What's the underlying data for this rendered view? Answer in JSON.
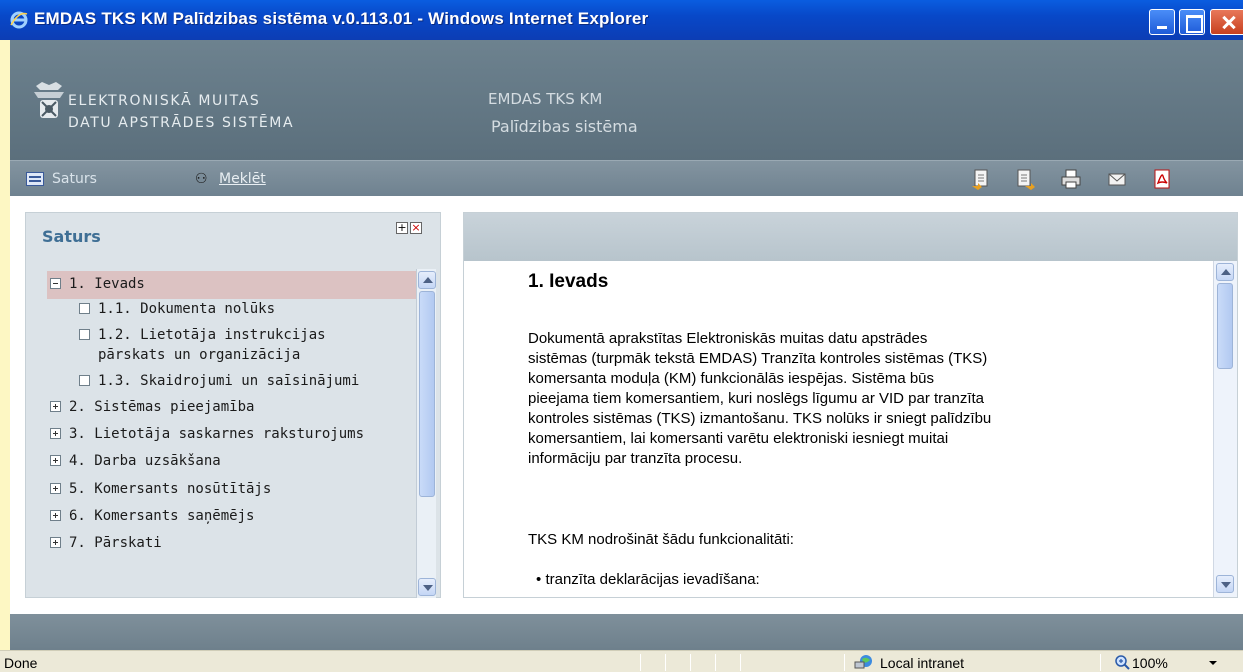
{
  "window": {
    "title": "EMDAS TKS KM Palīdzibas sistēma v.0.113.01 - Windows Internet Explorer"
  },
  "header": {
    "logo_line1": "ELEKTRONISKĀ MUITAS",
    "logo_line2": "DATU APSTRĀDES SISTĒMA",
    "app_name": "EMDAS TKS KM",
    "app_subtitle": "Palīdzibas sistēma"
  },
  "toolbar": {
    "saturs_label": "Saturs",
    "meklet_label": "Meklēt",
    "icons": [
      "previous-page-icon",
      "next-page-icon",
      "print-icon",
      "email-icon",
      "pdf-icon"
    ]
  },
  "toc": {
    "title": "Saturs",
    "items": [
      {
        "label": "1. Ievads",
        "toggle": "minus",
        "level": 0,
        "selected": true
      },
      {
        "label": "1.1. Dokumenta nolūks",
        "toggle": "leaf",
        "level": 1
      },
      {
        "label": "1.2. Lietotāja instrukcijas",
        "label2": "pārskats un organizācija",
        "toggle": "leaf",
        "level": 1
      },
      {
        "label": "1.3. Skaidrojumi un saīsinājumi",
        "toggle": "leaf",
        "level": 1
      },
      {
        "label": "2. Sistēmas pieejamība",
        "toggle": "plus",
        "level": 0
      },
      {
        "label": "3. Lietotāja saskarnes raksturojums",
        "toggle": "plus",
        "level": 0
      },
      {
        "label": "4. Darba uzsākšana",
        "toggle": "plus",
        "level": 0
      },
      {
        "label": "5. Komersants nosūtītājs",
        "toggle": "plus",
        "level": 0
      },
      {
        "label": "6. Komersants saņēmējs",
        "toggle": "plus",
        "level": 0
      },
      {
        "label": "7. Pārskati",
        "toggle": "plus",
        "level": 0
      }
    ]
  },
  "document": {
    "heading": "1. Ievads",
    "paragraph_lines": [
      "Dokumentā aprakstītas Elektroniskās muitas datu apstrādes",
      "sistēmas (turpmāk tekstā EMDAS) Tranzīta kontroles sistēmas (TKS)",
      "komersanta moduļa (KM) funkcionālās iespējas. Sistēma būs",
      "pieejama tiem komersantiem, kuri noslēgs līgumu ar VID par tranzīta",
      "kontroles sistēmas (TKS) izmantošanu. TKS nolūks ir sniegt palīdzību",
      "komersantiem, lai komersanti varētu elektroniski iesniegt muitai",
      "informāciju par tranzīta procesu."
    ],
    "paragraph2": "TKS KM nodrošināt šādu funkcionalitāti:",
    "list_item": "tranzīta deklarācijas ievadīšana:"
  },
  "statusbar": {
    "status": "Done",
    "zone": "Local intranet",
    "zoom": "100%"
  }
}
